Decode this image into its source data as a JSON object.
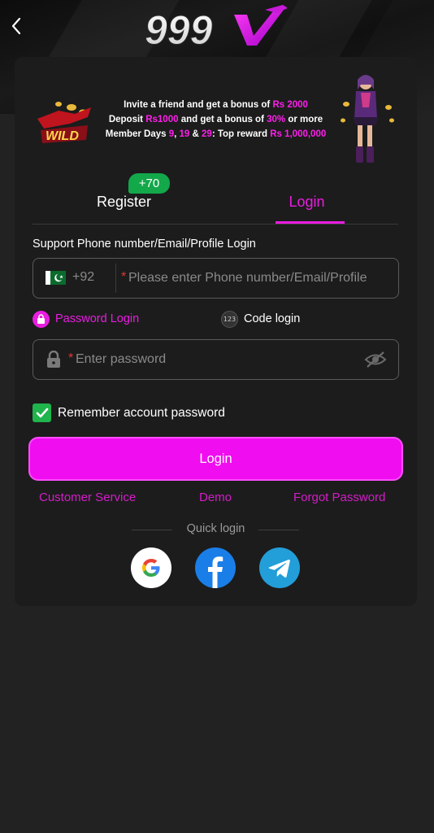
{
  "logo_text": "999V",
  "banner": {
    "line1_pre": "Invite a friend and get a bonus of ",
    "line1_amount": "Rs 2000",
    "line2_a": "Deposit ",
    "line2_amount": "Rs1000",
    "line2_b": " and get a bonus of ",
    "line2_pct": "30%",
    "line2_c": " or more",
    "line3_a": "Member Days ",
    "line3_d1": "9",
    "line3_sep1": ", ",
    "line3_d2": "19",
    "line3_sep2": " & ",
    "line3_d3": "29",
    "line3_b": ": Top reward ",
    "line3_reward": "Rs 1,000,000",
    "wild_label": "WILD"
  },
  "tabs": {
    "register_label": "Register",
    "register_badge": "+70",
    "login_label": "Login"
  },
  "form": {
    "support_label": "Support Phone number/Email/Profile Login",
    "country_code": "+92",
    "required_mark": "*",
    "phone_placeholder": "Please enter Phone number/Email/Profile",
    "password_login_label": "Password Login",
    "code_login_label": "Code login",
    "code_icon_text": "123",
    "password_placeholder": "Enter password",
    "remember_label": "Remember account password",
    "remember_checked": true,
    "login_button": "Login"
  },
  "links": {
    "customer_service": "Customer Service",
    "demo": "Demo",
    "forgot_password": "Forgot Password"
  },
  "quick_login": {
    "label": "Quick login",
    "providers": [
      "google-icon",
      "facebook-icon",
      "telegram-icon"
    ]
  },
  "colors": {
    "accent": "#e91de0",
    "button": "#f00df0",
    "badge": "#13a84a",
    "background": "#222222",
    "card": "#1c1c1c"
  }
}
